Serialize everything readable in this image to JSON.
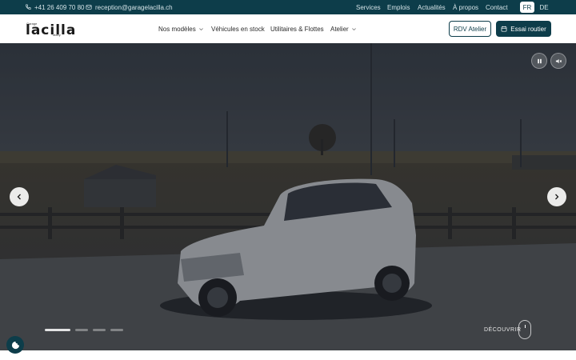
{
  "topbar": {
    "phone": "+41 26 409 70 80",
    "email": "reception@garagelacilla.ch",
    "links": [
      "Services",
      "Emplois",
      "Actualités",
      "À propos",
      "Contact"
    ],
    "lang_active": "FR",
    "lang_other": "DE"
  },
  "header": {
    "logo_small": "Garage",
    "logo_main": "lacilla",
    "logo_sub": "Marly",
    "menu": [
      "Nos modèles",
      "Véhicules en stock",
      "Utilitaires & Flottes",
      "Atelier"
    ],
    "btn_rdv": "RDV Atelier",
    "btn_essai": "Essai routier"
  },
  "hero": {
    "discover": "DÉCOUVRIR",
    "slides_total": 4,
    "slide_active": 1
  },
  "colors": {
    "brand": "#0d3d4a",
    "white": "#ffffff"
  },
  "icons": [
    "phone-icon",
    "mail-icon",
    "chevron-down-icon",
    "calendar-icon",
    "pause-icon",
    "mute-icon",
    "arrow-left-icon",
    "arrow-right-icon",
    "cookie-icon"
  ]
}
